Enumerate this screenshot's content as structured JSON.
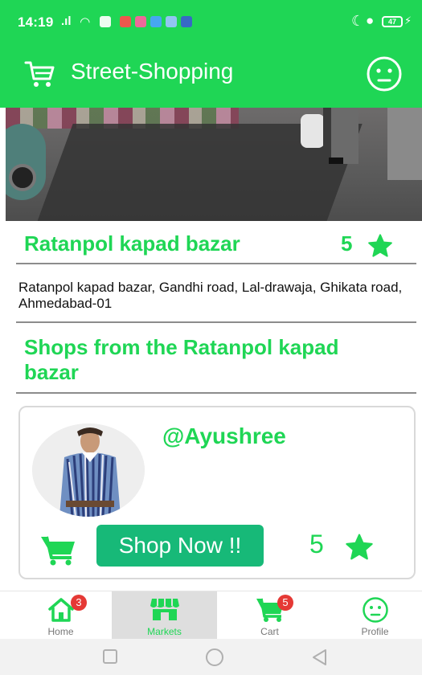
{
  "status_bar": {
    "time": "14:19",
    "battery": "47"
  },
  "app_bar": {
    "title": "Street-Shopping",
    "cart_icon": "cart-outline-icon",
    "profile_icon": "smiley-face-icon"
  },
  "market": {
    "name": "Ratanpol kapad bazar",
    "rating": "5",
    "address": "Ratanpol kapad bazar,  Gandhi road, Lal-drawaja,  Ghikata road, Ahmedabad-01",
    "shops_heading": "Shops from the Ratanpol kapad bazar"
  },
  "shop_card": {
    "handle": "@Ayushree",
    "button_label": "Shop Now !!",
    "rating": "5"
  },
  "bottom_nav": {
    "items": [
      {
        "label": "Home",
        "badge": "3",
        "icon": "home-icon"
      },
      {
        "label": "Markets",
        "badge": "",
        "icon": "store-icon"
      },
      {
        "label": "Cart",
        "badge": "5",
        "icon": "cart-icon"
      },
      {
        "label": "Profile",
        "badge": "",
        "icon": "smiley-face-icon"
      }
    ],
    "active_index": 1
  },
  "colors": {
    "primary": "#1fd655",
    "button": "#17b978",
    "badge": "#e53935"
  }
}
